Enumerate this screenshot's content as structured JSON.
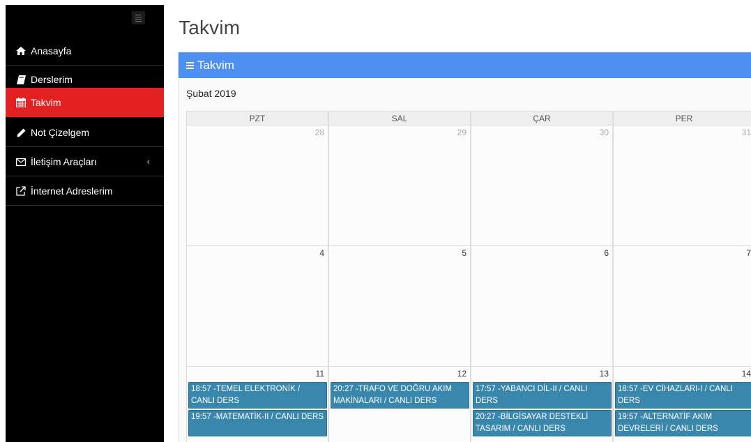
{
  "sidebar": {
    "items": [
      {
        "label": "Anasayfa",
        "icon": "home-icon",
        "glyph": "⌂"
      },
      {
        "label": "Derslerim",
        "icon": "book-icon",
        "glyph": ""
      },
      {
        "label": "Takvim",
        "icon": "calendar-icon",
        "glyph": "",
        "active": true
      },
      {
        "label": "Not Çizelgem",
        "icon": "pencil-icon",
        "glyph": "✎"
      },
      {
        "label": "İletişim Araçları",
        "icon": "envelope-icon",
        "glyph": "✉",
        "caret": "‹"
      },
      {
        "label": "İnternet Adreslerim",
        "icon": "external-link-icon",
        "glyph": ""
      }
    ]
  },
  "page": {
    "title": "Takvim"
  },
  "panel": {
    "title": "Takvim"
  },
  "calendar": {
    "month": "Şubat 2019",
    "weekdays": [
      "PZT",
      "SAL",
      "ÇAR",
      "PER"
    ],
    "weeks": [
      [
        "28",
        "29",
        "30",
        "31"
      ],
      [
        "4",
        "5",
        "6",
        "7"
      ],
      [
        "11",
        "12",
        "13",
        "14"
      ]
    ],
    "events": {
      "mon": [
        "18:57 -TEMEL ELEKTRONİK / CANLI DERS",
        "19:57 -MATEMATİK-II / CANLI DERS"
      ],
      "tue": [
        "20:27 -TRAFO VE DOĞRU AKIM MAKİNALARI / CANLI DERS"
      ],
      "wed": [
        "17:57 -YABANCI DİL-II / CANLI DERS",
        "20:27 -BİLGİSAYAR DESTEKLİ TASARIM / CANLI DERS"
      ],
      "thu": [
        "18:57 -EV CİHAZLARI-I / CANLI DERS",
        "19:57 -ALTERNATİF AKIM DEVRELERİ / CANLI DERS"
      ]
    }
  },
  "colors": {
    "sidebar_bg": "#000000",
    "active_item": "#e32020",
    "panel_header": "#4d90f0",
    "event_bg": "#3a87ad"
  }
}
